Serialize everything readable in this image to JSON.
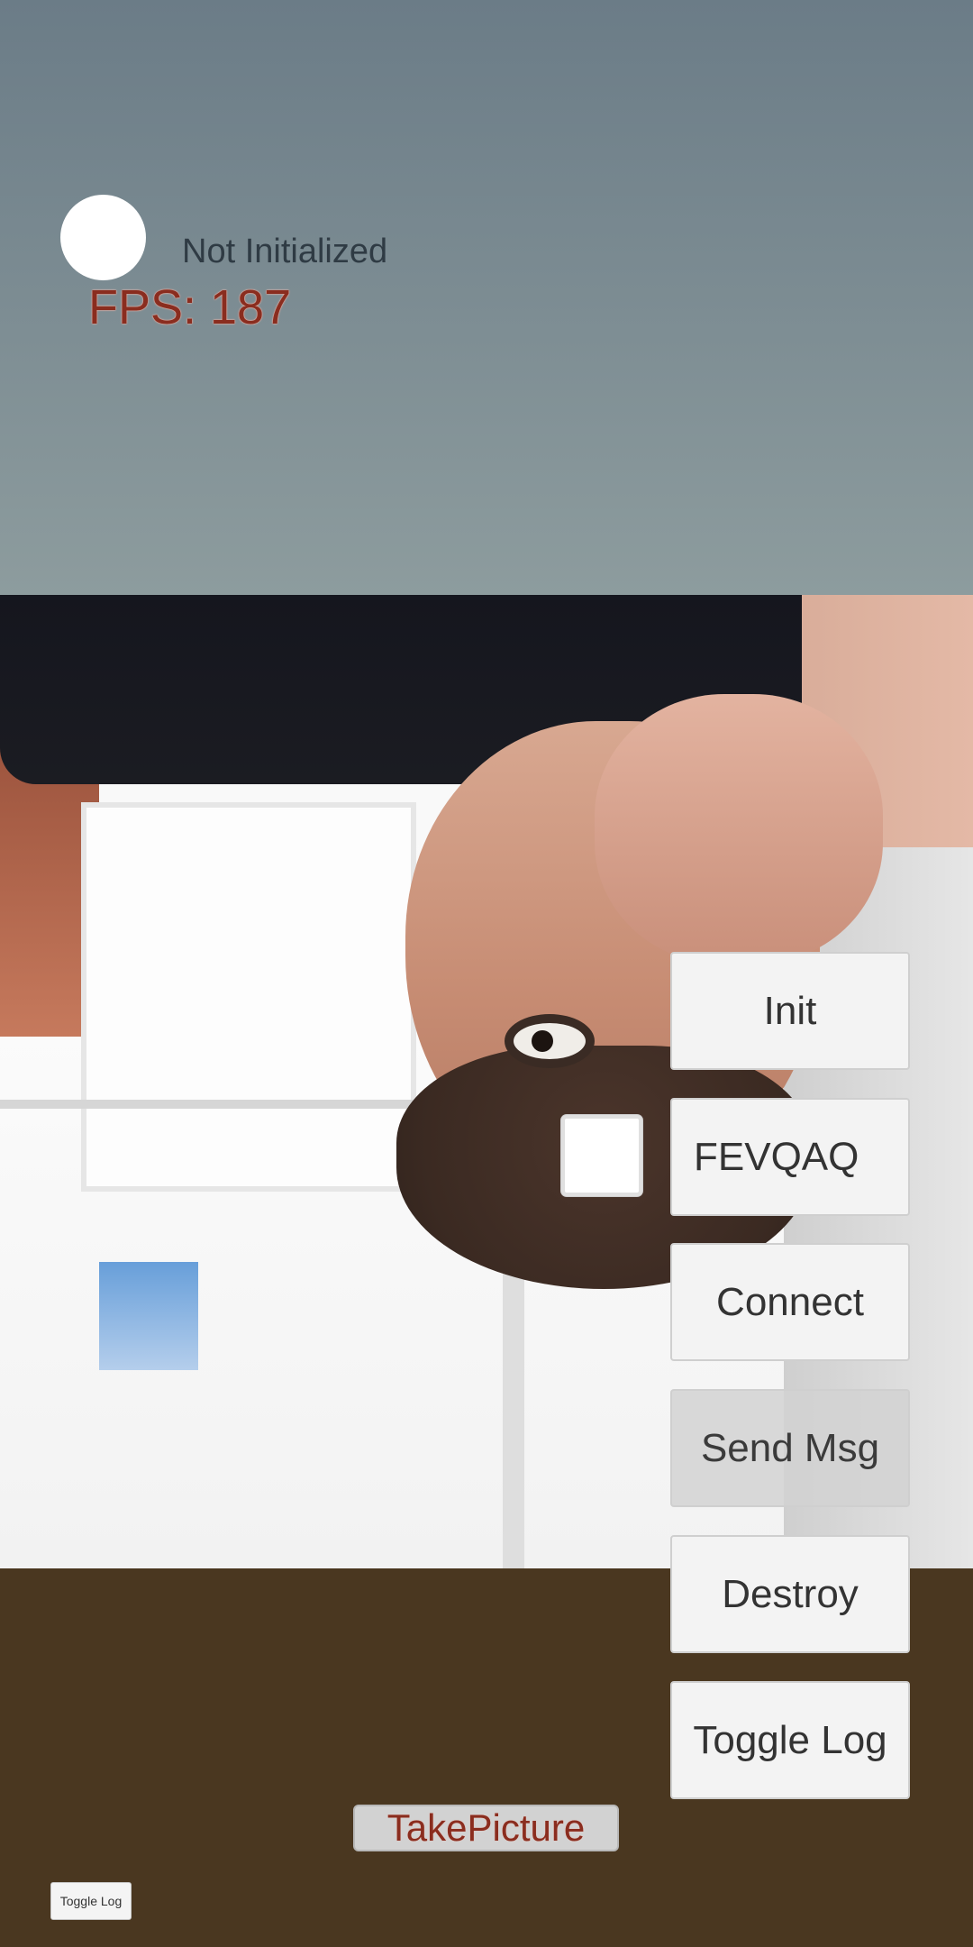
{
  "status": {
    "indicator_color": "#ffffff",
    "text": "Not Initialized"
  },
  "fps": {
    "text": "FPS: 187"
  },
  "buttons": {
    "init_label": "Init",
    "code_value": "FEVQAQ",
    "connect_label": "Connect",
    "send_msg_label": "Send Msg",
    "destroy_label": "Destroy",
    "toggle_log_label": "Toggle Log",
    "take_picture_label": "TakePicture",
    "small_toggle_log_label": "Toggle Log"
  },
  "colors": {
    "sky": "#6b7c87",
    "ground": "#4a3720",
    "fps_text": "#8a2d1f",
    "button_bg": "#f3f3f3"
  }
}
